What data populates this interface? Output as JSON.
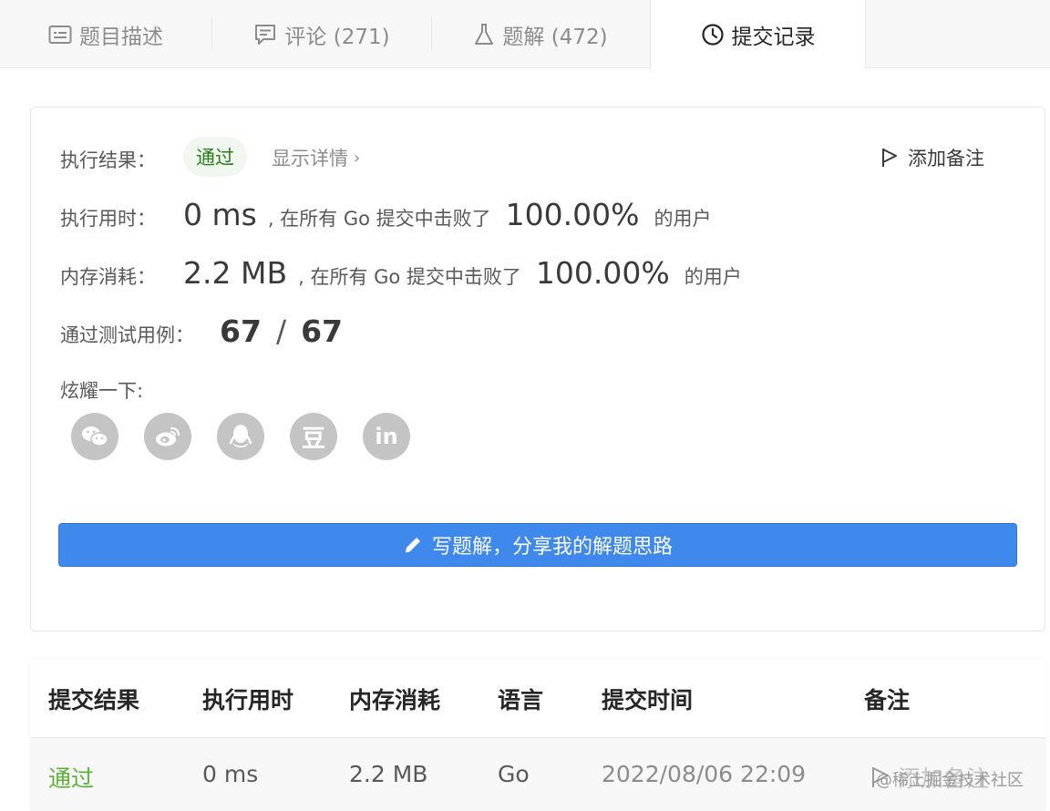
{
  "tabs": [
    {
      "label": "题目描述",
      "icon": "description-icon"
    },
    {
      "label": "评论 (271)",
      "icon": "comment-icon"
    },
    {
      "label": "题解 (472)",
      "icon": "flask-icon"
    },
    {
      "label": "提交记录",
      "icon": "clock-icon",
      "active": true
    }
  ],
  "result": {
    "status_label": "执行结果：",
    "status": "通过",
    "details_link": "显示详情",
    "add_note": "添加备注",
    "runtime_label": "执行用时：",
    "runtime_value": "0 ms",
    "runtime_mid": ", 在所有 Go 提交中击败了",
    "runtime_pct": "100.00%",
    "runtime_tail": "的用户",
    "memory_label": "内存消耗：",
    "memory_value": "2.2 MB",
    "memory_mid": ", 在所有 Go 提交中击败了",
    "memory_pct": "100.00%",
    "memory_tail": "的用户",
    "tests_label": "通过测试用例：",
    "tests_passed": "67",
    "tests_sep": "/",
    "tests_total": "67",
    "share_label": "炫耀一下:",
    "share_icons": [
      "wechat-icon",
      "weibo-icon",
      "qq-icon",
      "douban-icon",
      "linkedin-icon"
    ],
    "douban_glyph": "豆",
    "linkedin_glyph": "in",
    "write_solution": "写题解，分享我的解题思路"
  },
  "table": {
    "headers": [
      "提交结果",
      "执行用时",
      "内存消耗",
      "语言",
      "提交时间",
      "备注"
    ],
    "row": {
      "result": "通过",
      "runtime": "0 ms",
      "memory": "2.2 MB",
      "language": "Go",
      "time": "2022/08/06 22:09",
      "note": "添加备注"
    }
  },
  "watermark": "@稀土掘金技术社区",
  "colors": {
    "accent": "#3f89ec",
    "success": "#5cb338",
    "pill_bg": "#f0f7ee",
    "share_grey": "#c4c4c4"
  }
}
